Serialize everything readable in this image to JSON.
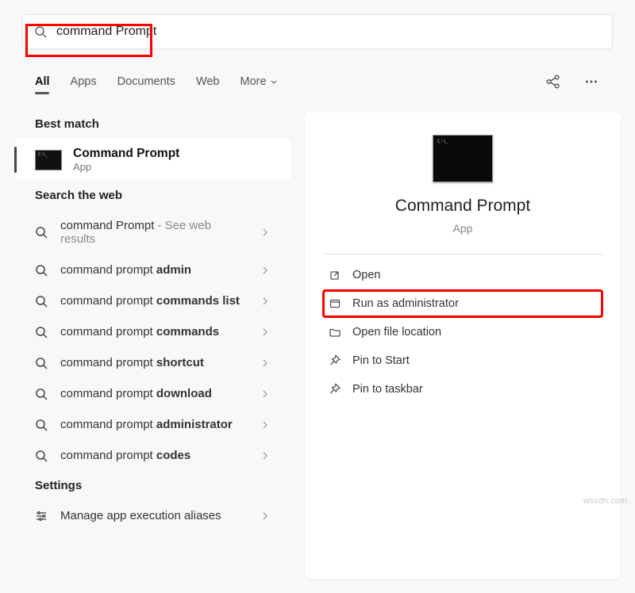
{
  "search": {
    "query": "command Prompt"
  },
  "tabs": [
    "All",
    "Apps",
    "Documents",
    "Web",
    "More"
  ],
  "sections": {
    "best": "Best match",
    "web": "Search the web",
    "settings": "Settings"
  },
  "bestMatch": {
    "name": "Command Prompt",
    "type": "App"
  },
  "webResults": [
    {
      "prefix": "command Prompt",
      "bold": "",
      "suffix": " - See web results"
    },
    {
      "prefix": "command prompt ",
      "bold": "admin",
      "suffix": ""
    },
    {
      "prefix": "command prompt ",
      "bold": "commands list",
      "suffix": ""
    },
    {
      "prefix": "command prompt ",
      "bold": "commands",
      "suffix": ""
    },
    {
      "prefix": "command prompt ",
      "bold": "shortcut",
      "suffix": ""
    },
    {
      "prefix": "command prompt ",
      "bold": "download",
      "suffix": ""
    },
    {
      "prefix": "command prompt ",
      "bold": "administrator",
      "suffix": ""
    },
    {
      "prefix": "command prompt ",
      "bold": "codes",
      "suffix": ""
    }
  ],
  "settingsItems": [
    "Manage app execution aliases"
  ],
  "preview": {
    "title": "Command Prompt",
    "type": "App"
  },
  "actions": [
    {
      "icon": "open",
      "label": "Open"
    },
    {
      "icon": "admin",
      "label": "Run as administrator"
    },
    {
      "icon": "folder",
      "label": "Open file location"
    },
    {
      "icon": "pin",
      "label": "Pin to Start"
    },
    {
      "icon": "pin",
      "label": "Pin to taskbar"
    }
  ],
  "watermark": "wsxdn.com"
}
